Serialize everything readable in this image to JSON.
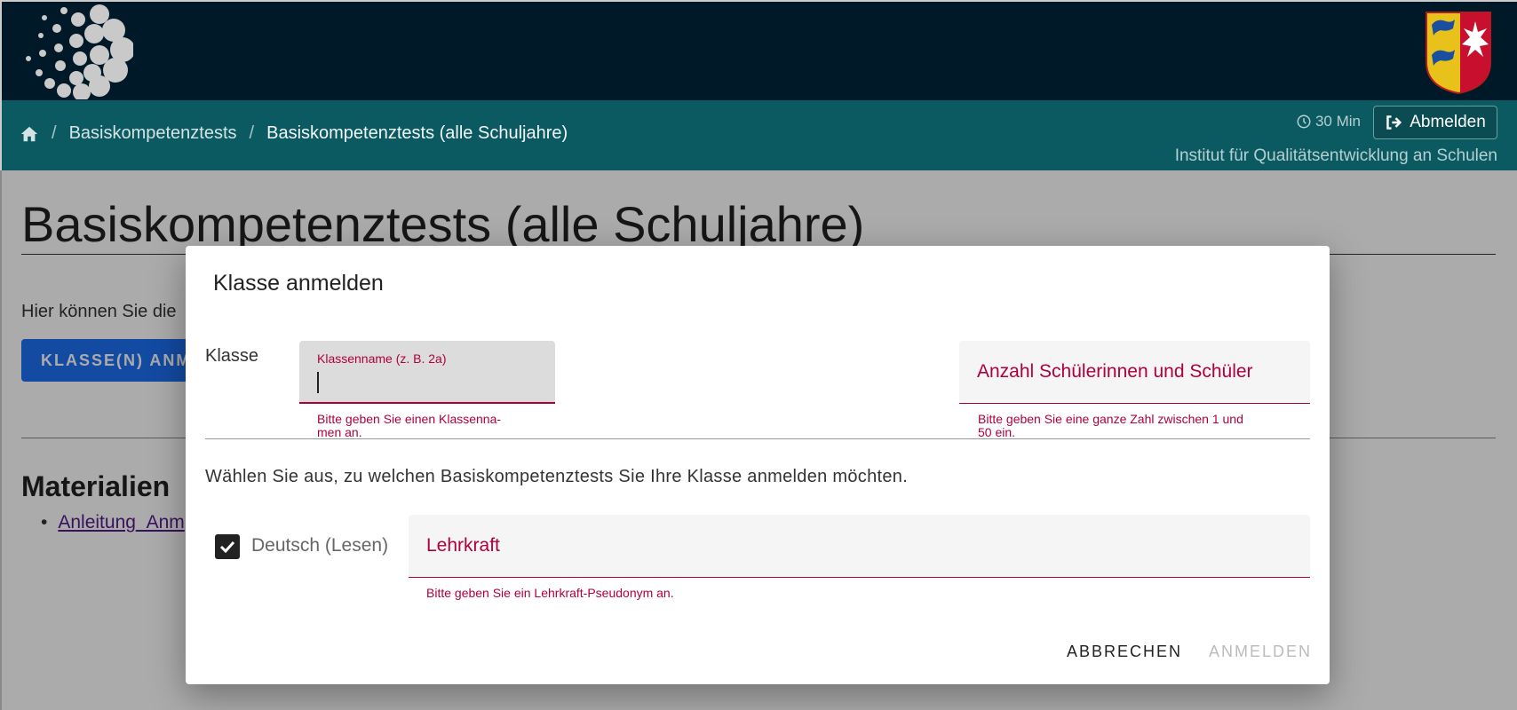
{
  "header": {
    "logo_icon": "dots-logo-icon",
    "crest_icon": "coat-of-arms-icon"
  },
  "breadcrumb": {
    "home_icon": "home-icon",
    "items": [
      "Basiskompetenztests",
      "Basiskompetenztests (alle Schuljahre)"
    ]
  },
  "session": {
    "timer": "30 Min",
    "logout_label": "Abmelden",
    "institute": "Institut für Qualitätsentwicklung an Schulen"
  },
  "page": {
    "title": "Basiskompetenztests (alle Schuljahre)",
    "intro": "Hier können Sie die",
    "register_button": "KLASSE(N) ANM",
    "materials_heading": "Materialien",
    "materials": [
      "Anleitung_Anm"
    ]
  },
  "dialog": {
    "title": "Klasse anmelden",
    "klasse_label": "Klasse",
    "classname_field": {
      "label": "Klassenname (z. B. 2a)",
      "value": "",
      "hint_line1": "Bitte geben Sie einen Klassenna-",
      "hint_line2": "men an."
    },
    "count_field": {
      "label": "Anzahl Schülerinnen und Schüler",
      "hint_line1": "Bitte geben Sie eine ganze Zahl zwischen 1 und",
      "hint_line2": "50 ein."
    },
    "choose_text": "Wählen Sie aus, zu welchen Basiskompetenztests Sie Ihre Klasse anmelden möchten.",
    "test_option": {
      "label": "Deutsch (Lesen)",
      "checked": true
    },
    "teacher_field": {
      "label": "Lehrkraft",
      "hint": "Bitte geben Sie ein Lehrkraft-Pseudonym an."
    },
    "cancel_label": "ABBRECHEN",
    "submit_label": "ANMELDEN"
  },
  "colors": {
    "header_bg": "#001928",
    "navbar_bg": "#0b5a61",
    "error": "#b0003a",
    "primary": "#1d6ff2"
  }
}
